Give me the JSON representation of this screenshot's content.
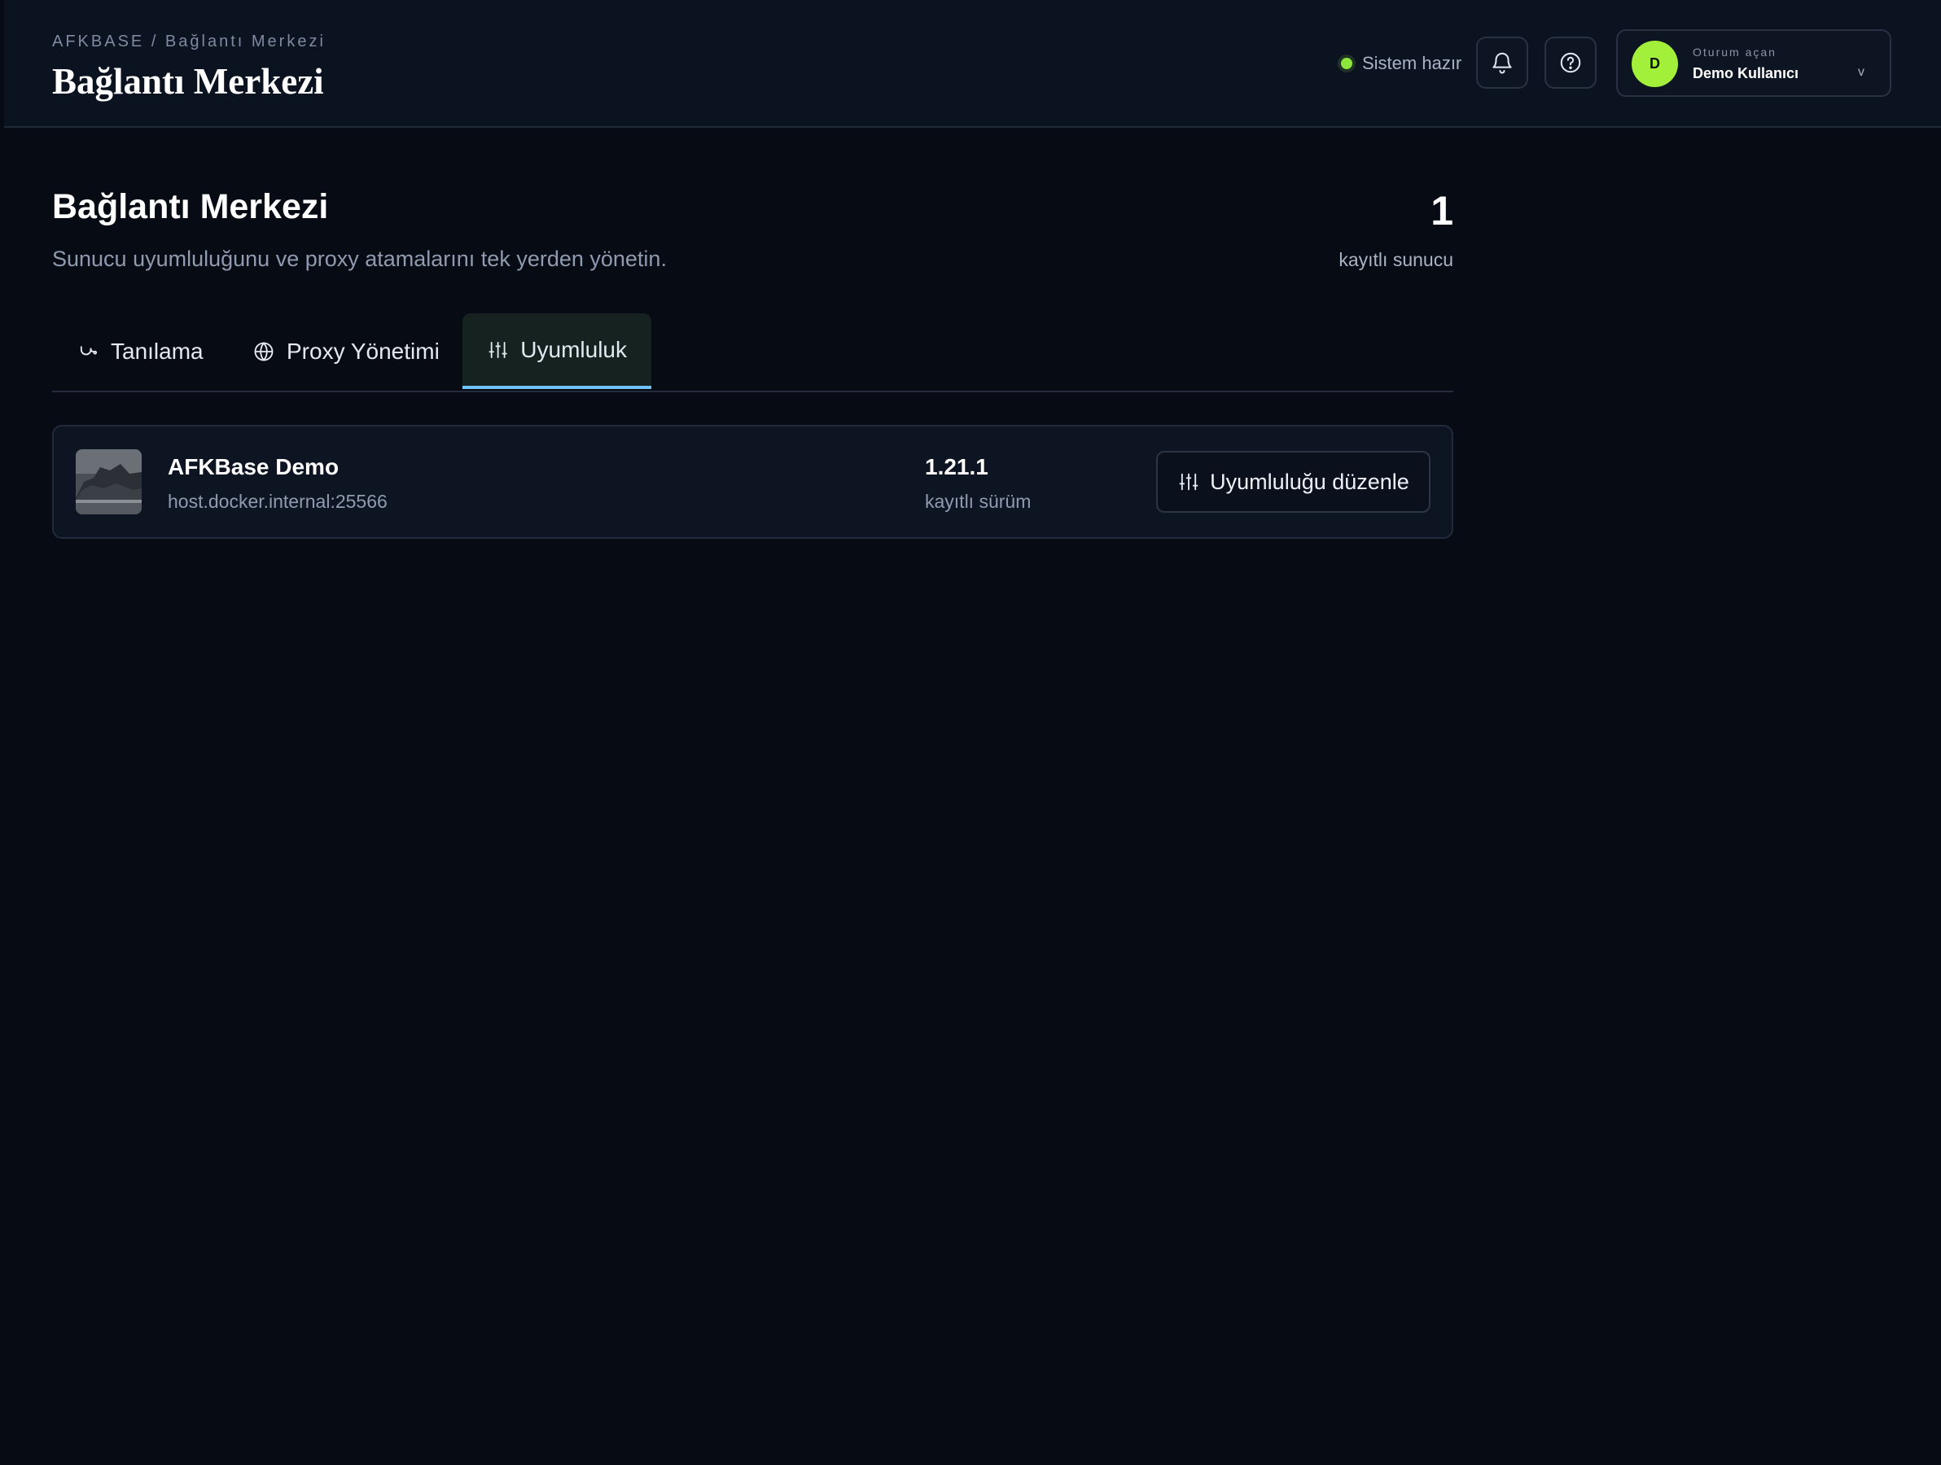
{
  "header": {
    "breadcrumb": "AFKBASE / Bağlantı Merkezi",
    "title": "Bağlantı Merkezi",
    "status_text": "Sistem hazır",
    "status_color": "#8ce63c",
    "notifications_icon": "bell-icon",
    "help_icon": "help-circle-icon"
  },
  "user": {
    "initial": "D",
    "caption": "Oturum açan",
    "name": "Demo Kullanıcı",
    "chevron": "v",
    "avatar_color": "#a3f03a"
  },
  "page": {
    "title": "Bağlantı Merkezi",
    "subtitle": "Sunucu uyumluluğunu ve proxy atamalarını tek yerden yönetin.",
    "count_value": "1",
    "count_label": "kayıtlı sunucu"
  },
  "tabs": [
    {
      "label": "Tanılama",
      "icon": "stethoscope-icon",
      "active": false
    },
    {
      "label": "Proxy Yönetimi",
      "icon": "globe-icon",
      "active": false
    },
    {
      "label": "Uyumluluk",
      "icon": "sliders-icon",
      "active": true
    }
  ],
  "servers": [
    {
      "name": "AFKBase Demo",
      "host": "host.docker.internal:25566",
      "version": "1.21.1",
      "version_label": "kayıtlı sürüm",
      "action_label": "Uyumluluğu düzenle"
    }
  ],
  "accent_color": "#6fc3f7"
}
